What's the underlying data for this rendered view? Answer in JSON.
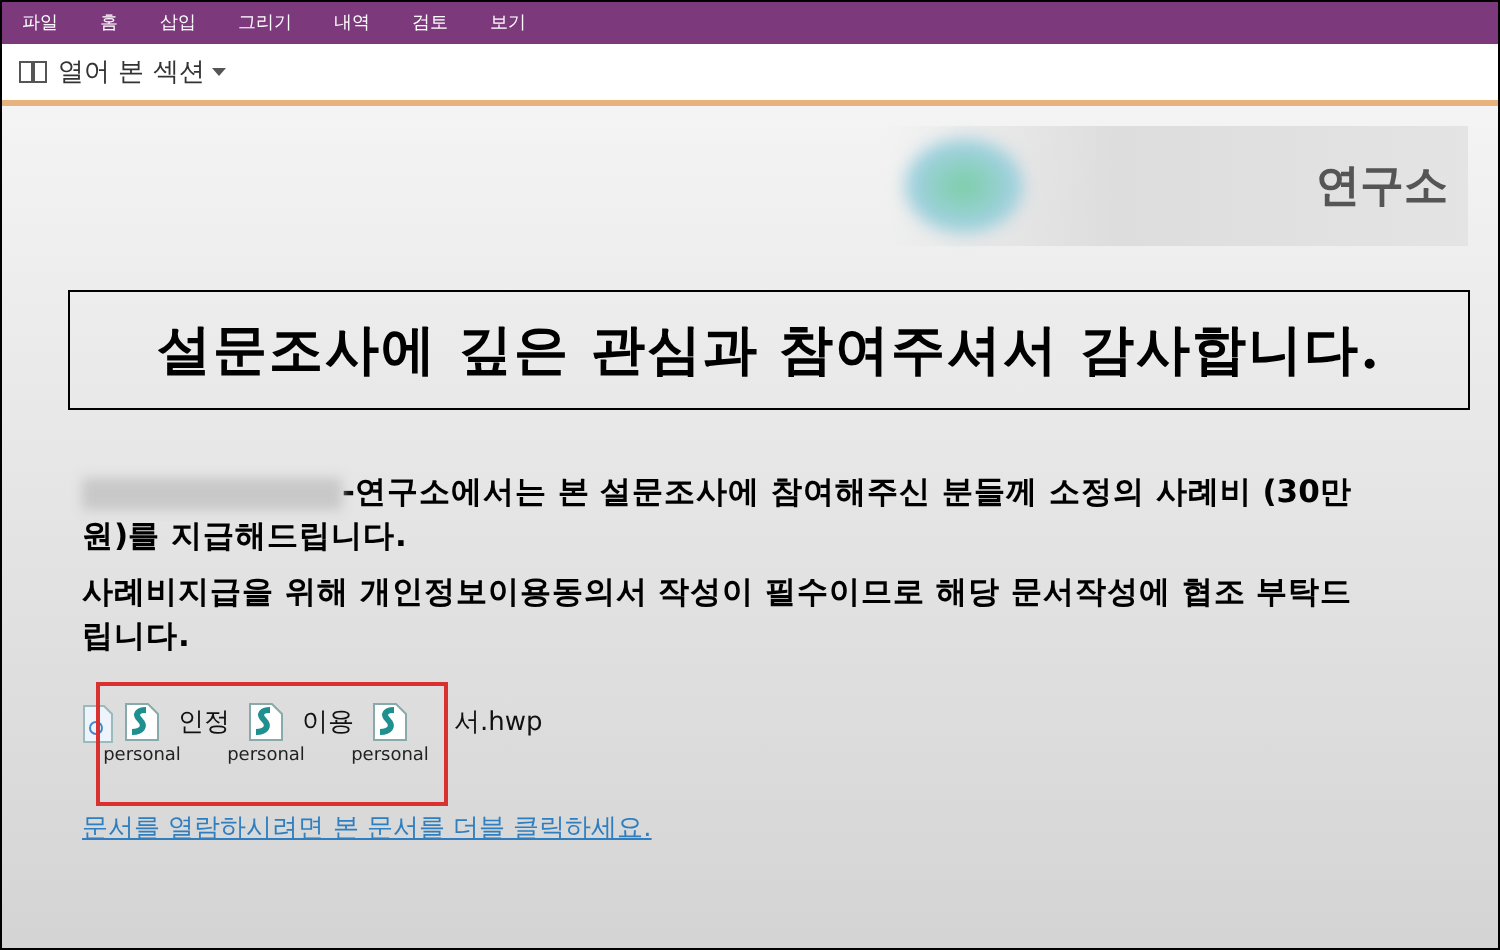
{
  "menu": [
    {
      "label": "파일",
      "selected": false
    },
    {
      "label": "홈",
      "selected": false
    },
    {
      "label": "삽입",
      "selected": false
    },
    {
      "label": "그리기",
      "selected": false
    },
    {
      "label": "내역",
      "selected": false
    },
    {
      "label": "검토",
      "selected": false
    },
    {
      "label": "보기",
      "selected": false
    }
  ],
  "section_bar": {
    "label": "열어 본 섹션"
  },
  "logo": {
    "text": "연구소"
  },
  "title": "설문조사에 깊은 관심과 참여주셔서 감사합니다.",
  "paragraphs": [
    {
      "text": "-연구소에서는 본 설문조사에 참여해주신 분들께 소정의 사례비 (30만원)를 지급해드립니다.",
      "redacted_prefix": true
    },
    {
      "text": "사례비지급을 위해 개인정보이용동의서 작성이 필수이므로 해당 문서작성에 협조 부탁드립니다.",
      "redacted_prefix": false
    }
  ],
  "attachment": {
    "parts": [
      {
        "kind": "embed",
        "label": "personal"
      },
      {
        "kind": "text",
        "text": "인정"
      },
      {
        "kind": "embed",
        "label": "personal"
      },
      {
        "kind": "text",
        "text": "이용"
      },
      {
        "kind": "embed",
        "label": "personal"
      },
      {
        "kind": "text",
        "text": "서.hwp"
      }
    ]
  },
  "hint_link": "문서를 열람하시려면 본 문서를 더블 클릭하세요."
}
